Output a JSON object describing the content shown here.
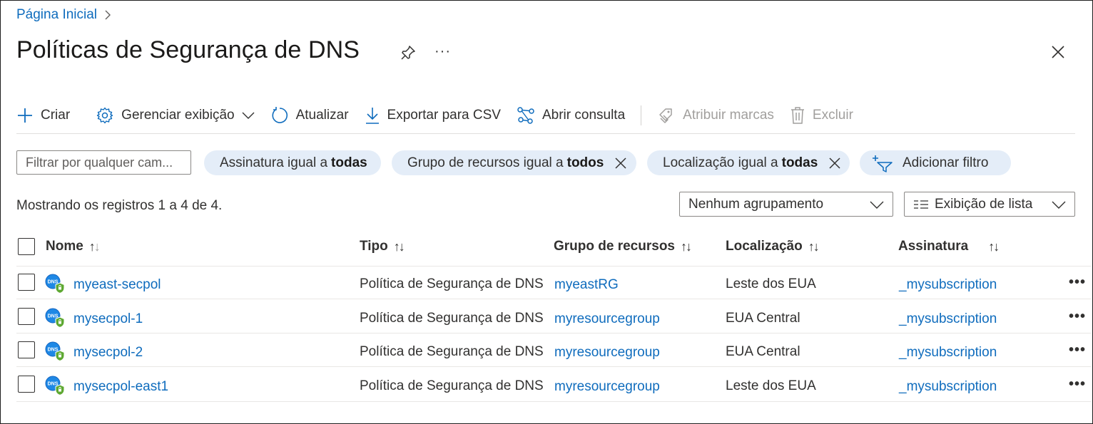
{
  "breadcrumb": {
    "home": "Página Inicial"
  },
  "page": {
    "title": "Políticas de Segurança de DNS",
    "more": "···"
  },
  "toolbar": {
    "create": "Criar",
    "manage_view": "Gerenciar exibição",
    "refresh": "Atualizar",
    "export_csv": "Exportar para CSV",
    "open_query": "Abrir consulta",
    "assign_tags": "Atribuir marcas",
    "delete": "Excluir"
  },
  "filters": {
    "search_placeholder": "Filtrar por qualquer cam...",
    "subscription": {
      "label": "Assinatura igual a",
      "value": "todas"
    },
    "resource_group": {
      "label": "Grupo de recursos igual a",
      "value": "todos"
    },
    "location": {
      "label": "Localização igual a",
      "value": "todas"
    },
    "add_filter": "Adicionar filtro"
  },
  "records_text": "Mostrando os registros 1 a 4 de 4.",
  "grouping": {
    "selected": "Nenhum agrupamento"
  },
  "view": {
    "selected": "Exibição de lista"
  },
  "table": {
    "columns": {
      "name": "Nome",
      "type": "Tipo",
      "resource_group": "Grupo de recursos",
      "location": "Localização",
      "subscription": "Assinatura"
    },
    "icon_label": "DNS",
    "rows": [
      {
        "name": "myeast-secpol",
        "type": "Política de Segurança de DNS",
        "resource_group": "myeastRG",
        "location": "Leste dos EUA",
        "subscription": "_mysubscription",
        "more": "•••"
      },
      {
        "name": "mysecpol-1",
        "type": "Política de Segurança de DNS",
        "resource_group": "myresourcegroup",
        "location": "EUA Central",
        "subscription": "_mysubscription",
        "more": "•••"
      },
      {
        "name": "mysecpol-2",
        "type": "Política de Segurança de DNS",
        "resource_group": "myresourcegroup",
        "location": "EUA Central",
        "subscription": "_mysubscription",
        "more": "•••"
      },
      {
        "name": "mysecpol-east1",
        "type": "Política de Segurança de DNS",
        "resource_group": "myresourcegroup",
        "location": "Leste dos EUA",
        "subscription": "_mysubscription",
        "more": "•••"
      }
    ]
  },
  "colors": {
    "link": "#0f6cbd",
    "pill_bg": "#e4edf8",
    "icon_blue": "#1e88e5",
    "icon_green": "#5ea832"
  }
}
